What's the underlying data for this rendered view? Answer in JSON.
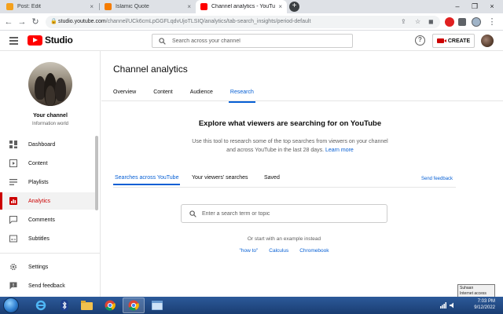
{
  "browser": {
    "tabs": [
      {
        "title": "Post: Edit",
        "favicon_color": "#f4a11d",
        "active": false
      },
      {
        "title": "Islamic Quote",
        "favicon_color": "#f57c00",
        "active": false
      },
      {
        "title": "Channel analytics - YouTube Studio",
        "favicon_color": "#ff0000",
        "active": true
      }
    ],
    "new_tab_label": "+",
    "url": {
      "host": "studio.youtube.com",
      "path": "/channel/UCk6cmLpGGFLqdvUjoTLSIQ/analytics/tab-search_insights/period-default"
    }
  },
  "header": {
    "logo_text": "Studio",
    "search_placeholder": "Search across your channel",
    "create_label": "CREATE"
  },
  "sidebar": {
    "channel_title": "Your channel",
    "channel_subtitle": "Information world",
    "items": [
      {
        "label": "Dashboard",
        "icon": "dashboard-icon",
        "active": false
      },
      {
        "label": "Content",
        "icon": "content-icon",
        "active": false
      },
      {
        "label": "Playlists",
        "icon": "playlists-icon",
        "active": false
      },
      {
        "label": "Analytics",
        "icon": "analytics-icon",
        "active": true
      },
      {
        "label": "Comments",
        "icon": "comments-icon",
        "active": false
      },
      {
        "label": "Subtitles",
        "icon": "subtitles-icon",
        "active": false
      }
    ],
    "bottom_items": [
      {
        "label": "Settings",
        "icon": "gear-icon"
      },
      {
        "label": "Send feedback",
        "icon": "feedback-icon"
      }
    ]
  },
  "main": {
    "title": "Channel analytics",
    "tabs": [
      {
        "label": "Overview",
        "active": false
      },
      {
        "label": "Content",
        "active": false
      },
      {
        "label": "Audience",
        "active": false
      },
      {
        "label": "Research",
        "active": true
      }
    ],
    "research": {
      "heading": "Explore what viewers are searching for on YouTube",
      "description": "Use this tool to research some of the top searches from viewers on your channel and across YouTube in the last 28 days.",
      "learn_more": "Learn more",
      "subtabs": [
        {
          "label": "Searches across YouTube",
          "active": true
        },
        {
          "label": "Your viewers' searches",
          "active": false
        },
        {
          "label": "Saved",
          "active": false
        }
      ],
      "send_feedback": "Send feedback",
      "search_placeholder": "Enter a search term or topic",
      "example_prompt": "Or start with an example instead",
      "examples": [
        "\"how to\"",
        "Calculus",
        "Chromebook"
      ]
    }
  },
  "taskbar": {
    "time": "7:03 PM",
    "date": "9/12/2022",
    "tooltip_line1": "Suhaan",
    "tooltip_line2": "Internet access"
  },
  "colors": {
    "accent_blue": "#065fd4",
    "brand_red": "#ff0000",
    "active_red": "#cc0000"
  }
}
